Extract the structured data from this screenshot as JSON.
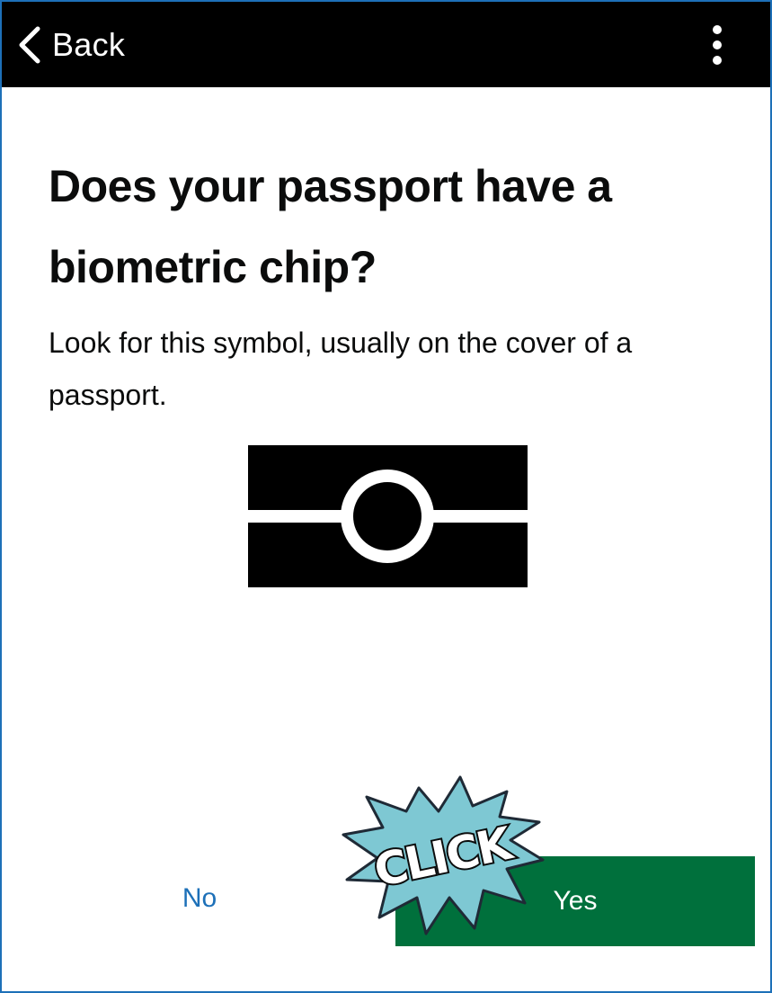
{
  "header": {
    "back_label": "Back",
    "back_icon": "chevron-left-icon",
    "menu_icon": "more-vertical-icon"
  },
  "main": {
    "heading": "Does your passport have a biometric chip?",
    "body": "Look for this symbol, usually on the cover of a passport.",
    "symbol_icon": "biometric-chip-icon"
  },
  "actions": {
    "no_label": "No",
    "yes_label": "Yes"
  },
  "overlay": {
    "click_text": "CLICK",
    "click_icon": "click-burst-icon"
  },
  "colors": {
    "header_bg": "#000000",
    "link": "#1d70b8",
    "primary_button": "#00703c",
    "burst": "#7ec8d3",
    "text": "#0b0c0c"
  }
}
